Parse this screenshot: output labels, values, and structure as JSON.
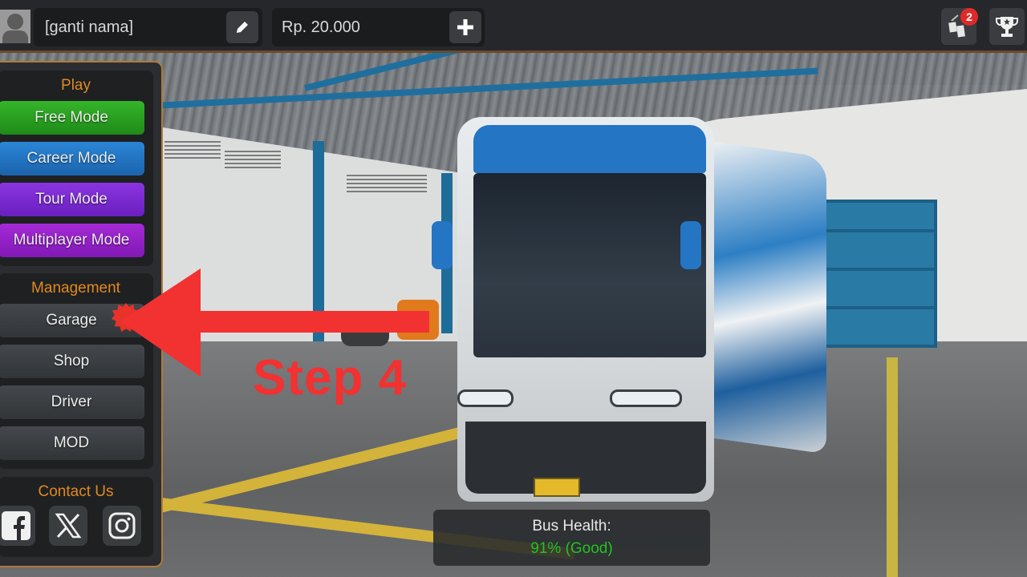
{
  "topbar": {
    "player_name": "[ganti nama]",
    "money": "Rp. 20.000",
    "notification_count": "2",
    "icons": {
      "avatar": "user-avatar-icon",
      "edit": "pencil-icon",
      "add_money": "plus-icon",
      "gift": "gift-icon",
      "achievements": "trophy-icon"
    }
  },
  "sidebar": {
    "play": {
      "title": "Play",
      "buttons": [
        {
          "label": "Free Mode",
          "color": "#2aa022"
        },
        {
          "label": "Career Mode",
          "color": "#2275c4"
        },
        {
          "label": "Tour Mode",
          "color": "#7a2bd0"
        },
        {
          "label": "Multiplayer Mode",
          "color": "#9422c6"
        }
      ]
    },
    "management": {
      "title": "Management",
      "buttons": [
        {
          "label": "Garage"
        },
        {
          "label": "Shop"
        },
        {
          "label": "Driver"
        },
        {
          "label": "MOD"
        }
      ]
    },
    "contact": {
      "title": "Contact Us",
      "socials": [
        "facebook-icon",
        "x-twitter-icon",
        "instagram-icon"
      ]
    }
  },
  "annotation": {
    "step_text": "Step 4",
    "color": "#f23131"
  },
  "bus_health": {
    "label": "Bus Health:",
    "value": "91% (Good)",
    "percent": 91,
    "status_color": "#22c322"
  }
}
